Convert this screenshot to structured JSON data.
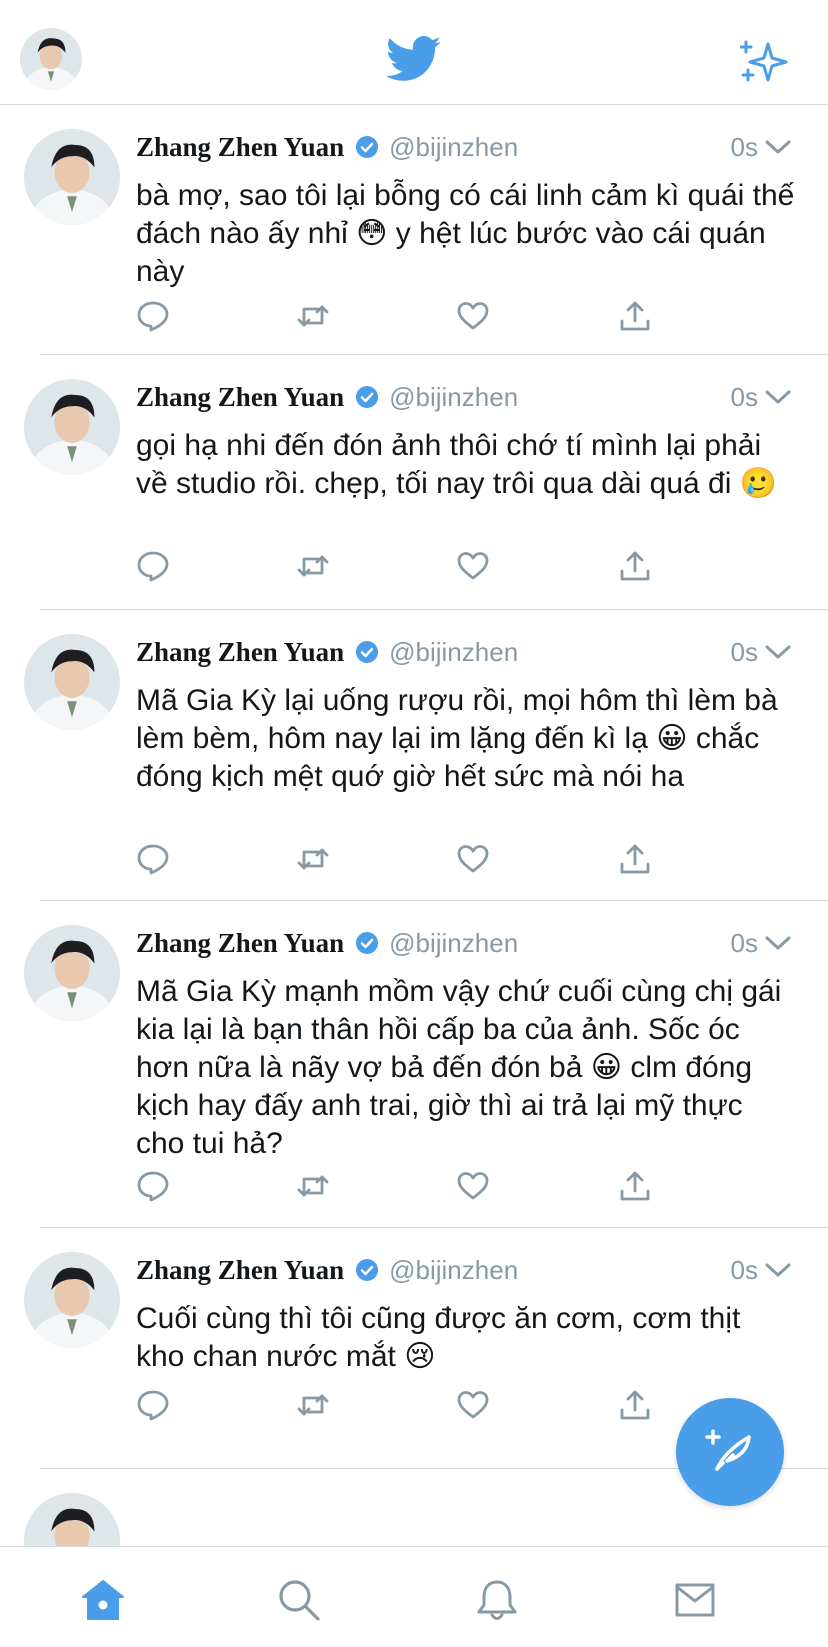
{
  "header": {
    "logo_icon": "twitter-bird-icon",
    "sparkle_icon": "sparkle-icon"
  },
  "colors": {
    "accent": "#4a9de8",
    "muted": "#8899a6",
    "text": "#14171a",
    "divider": "#cfd9de"
  },
  "tweets": [
    {
      "name": "Zhang Zhen Yuan",
      "handle": "@bijinzhen",
      "time": "0s",
      "text": "bà mợ, sao tôi lại bỗng có cái linh cảm kì quái thế đách nào ấy nhỉ 😳 y hệt lúc bước vào cái quán này"
    },
    {
      "name": "Zhang Zhen Yuan",
      "handle": "@bijinzhen",
      "time": "0s",
      "text": "gọi hạ nhi đến đón ảnh thôi chớ tí mình lại phải về studio rồi. chẹp, tối nay trôi qua dài quá đi 🥲"
    },
    {
      "name": "Zhang Zhen Yuan",
      "handle": "@bijinzhen",
      "time": "0s",
      "text": "Mã Gia Kỳ lại uống rượu rồi, mọi hôm thì lèm bà lèm bèm, hôm nay lại im lặng đến kì lạ 😀 chắc đóng kịch mệt quớ giờ hết sức mà nói ha"
    },
    {
      "name": "Zhang Zhen Yuan",
      "handle": "@bijinzhen",
      "time": "0s",
      "text": "Mã Gia Kỳ mạnh mồm vậy chứ cuối cùng chị gái kia lại là bạn thân hồi cấp ba của ảnh. Sốc óc hơn nữa là nãy vợ bả đến đón bả 😀 clm đóng kịch hay đấy anh trai, giờ thì ai trả lại mỹ thực cho tui hả?"
    },
    {
      "name": "Zhang Zhen Yuan",
      "handle": "@bijinzhen",
      "time": "0s",
      "text": "Cuối cùng thì tôi cũng được ăn cơm, cơm thịt kho chan nước mắt 😢"
    }
  ],
  "actions": [
    "reply-icon",
    "retweet-icon",
    "like-icon",
    "share-icon"
  ],
  "fab": {
    "icon": "compose-feather-icon"
  },
  "tabbar": [
    "home-icon",
    "search-icon",
    "notifications-icon",
    "messages-icon"
  ]
}
